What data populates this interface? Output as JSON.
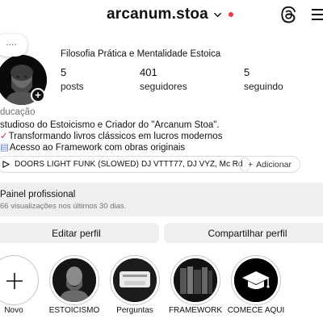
{
  "header": {
    "username": "arcanum.stoa",
    "icons": [
      "lock-icon",
      "chevron-down-icon",
      "notification-dot",
      "threads-icon",
      "menu-icon"
    ],
    "accent_dot_color": "#ff3040"
  },
  "profile": {
    "note": "....",
    "display_name": "Filosofia Prática e Mentalidade Estoica",
    "stats": [
      {
        "value": "5",
        "label": "posts"
      },
      {
        "value": "401",
        "label": "seguidores"
      },
      {
        "value": "5",
        "label": "seguindo"
      }
    ],
    "category": "ducação",
    "bio": [
      "studioso do Estoicismo e Criador do \"Arcanum Stoa\".",
      "Transformando livros clássicos em lucros modernos",
      "Acesso ao Framework com obras originais"
    ]
  },
  "music": {
    "title": "DOORS LIGHT FUNK (SLOWED)",
    "artists": "DJ VTTT77, DJ VYZ, Mc Rd",
    "add_label": "Adicionar"
  },
  "professional_panel": {
    "title": "Painel profissional",
    "subtitle": "66 visualizações nos últimos 30 dias."
  },
  "actions": {
    "edit_label": "Editar perfil",
    "share_label": "Compartilhar perfil"
  },
  "highlights": [
    {
      "label": "Novo",
      "icon": "plus-icon"
    },
    {
      "label": "ESTOICISMO",
      "icon": "bust-image"
    },
    {
      "label": "Perguntas",
      "icon": "question-box-image"
    },
    {
      "label": "FRAMEWORK",
      "icon": "book-stack-image"
    },
    {
      "label": "COMECE AQUI",
      "icon": "graduation-cap-icon"
    }
  ]
}
